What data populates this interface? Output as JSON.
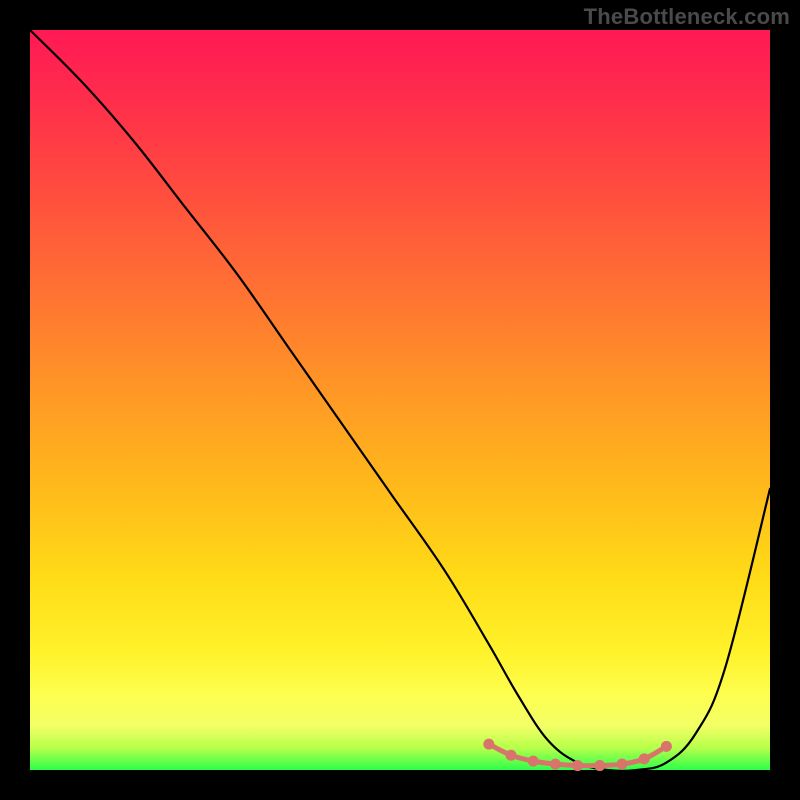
{
  "watermark": "TheBottleneck.com",
  "chart_data": {
    "type": "line",
    "title": "",
    "xlabel": "",
    "ylabel": "",
    "xlim": [
      0,
      100
    ],
    "ylim": [
      0,
      100
    ],
    "grid": false,
    "legend": false,
    "series": [
      {
        "name": "main-curve",
        "color": "#000000",
        "x": [
          0,
          7,
          14,
          21,
          28,
          35,
          42,
          49,
          56,
          62,
          66,
          70,
          74,
          78,
          82,
          86,
          90,
          94,
          100
        ],
        "y": [
          100,
          93,
          85,
          76,
          67,
          57,
          47,
          37,
          27,
          17,
          10,
          4,
          1,
          0,
          0,
          1,
          5,
          14,
          38
        ]
      },
      {
        "name": "trough-markers",
        "color": "#d9746c",
        "x": [
          62,
          65,
          68,
          71,
          74,
          77,
          80,
          83,
          86
        ],
        "y": [
          3.5,
          2.0,
          1.2,
          0.8,
          0.6,
          0.6,
          0.8,
          1.5,
          3.2
        ]
      }
    ],
    "annotations": []
  }
}
